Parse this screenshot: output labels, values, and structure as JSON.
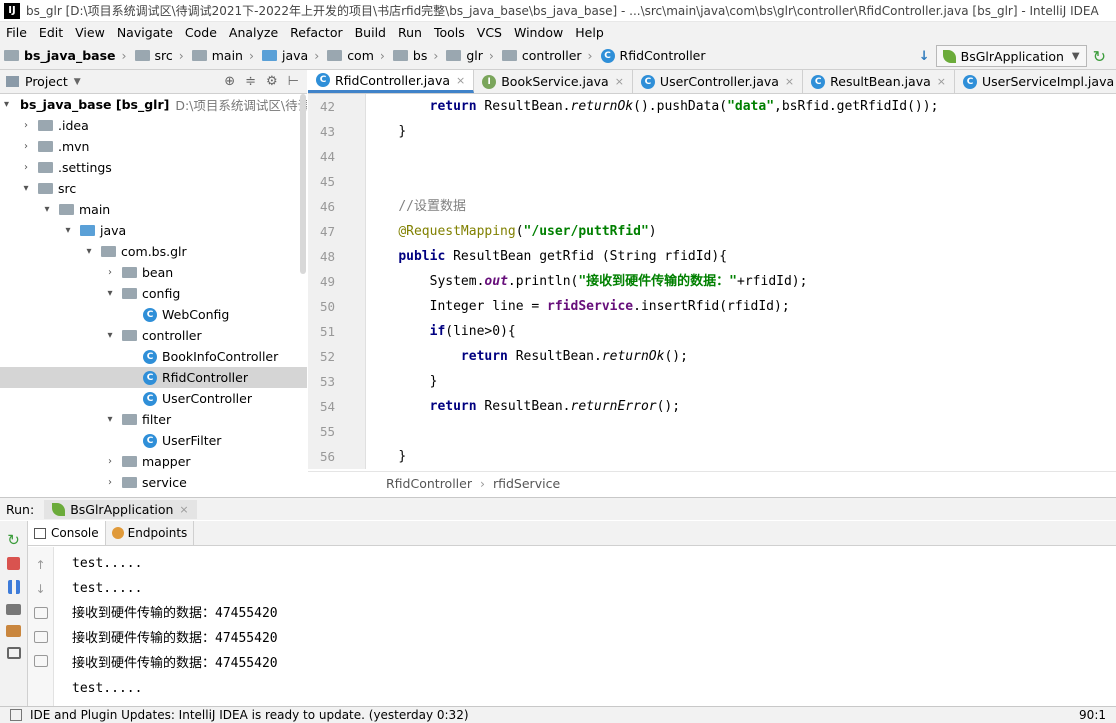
{
  "window": {
    "title": "bs_glr [D:\\项目系统调试区\\待调试2021下-2022年上开发的项目\\书店rfid完整\\bs_java_base\\bs_java_base] - ...\\src\\main\\java\\com\\bs\\glr\\controller\\RfidController.java [bs_glr] - IntelliJ IDEA"
  },
  "menu": [
    "File",
    "Edit",
    "View",
    "Navigate",
    "Code",
    "Analyze",
    "Refactor",
    "Build",
    "Run",
    "Tools",
    "VCS",
    "Window",
    "Help"
  ],
  "breadcrumb": [
    "bs_java_base",
    "src",
    "main",
    "java",
    "com",
    "bs",
    "glr",
    "controller",
    "RfidController"
  ],
  "run_config": "BsGlrApplication",
  "project_panel": {
    "title": "Project",
    "tree": [
      {
        "label": "bs_java_base [bs_glr]",
        "extra": "D:\\项目系统调试区\\待调试",
        "arrow": "open"
      },
      {
        "label": ".idea",
        "arrow": "closed"
      },
      {
        "label": ".mvn",
        "arrow": "closed"
      },
      {
        "label": ".settings",
        "arrow": "closed"
      },
      {
        "label": "src",
        "arrow": "open"
      },
      {
        "label": "main",
        "arrow": "open"
      },
      {
        "label": "java",
        "arrow": "open"
      },
      {
        "label": "com.bs.glr",
        "arrow": "open"
      },
      {
        "label": "bean",
        "arrow": "closed"
      },
      {
        "label": "config",
        "arrow": "open"
      },
      {
        "label": "WebConfig",
        "arrow": "none"
      },
      {
        "label": "controller",
        "arrow": "open"
      },
      {
        "label": "BookInfoController",
        "arrow": "none"
      },
      {
        "label": "RfidController",
        "arrow": "none",
        "selected": true
      },
      {
        "label": "UserController",
        "arrow": "none"
      },
      {
        "label": "filter",
        "arrow": "open"
      },
      {
        "label": "UserFilter",
        "arrow": "none"
      },
      {
        "label": "mapper",
        "arrow": "closed"
      },
      {
        "label": "service",
        "arrow": "closed"
      }
    ]
  },
  "editor_tabs": [
    "RfidController.java",
    "BookService.java",
    "UserController.java",
    "ResultBean.java",
    "UserServiceImpl.java",
    "Us"
  ],
  "line_numbers": [
    "42",
    "43",
    "44",
    "45",
    "46",
    "47",
    "48",
    "49",
    "50",
    "51",
    "52",
    "53",
    "54",
    "55",
    "56"
  ],
  "code": {
    "l42_kw": "return",
    "l42_a": " ResultBean.",
    "l42_m": "returnOk",
    "l42_b": "().pushData(",
    "l42_s": "\"data\"",
    "l42_c": ",bsRfid.getRfidId());",
    "l43": "}",
    "l46": "//设置数据",
    "l47_a": "@RequestMapping",
    "l47_b": "(",
    "l47_s": "\"/user/puttRfid\"",
    "l47_c": ")",
    "l48_kw": "public",
    "l48_a": " ResultBean getRfid (String rfidId){",
    "l49_a": "System.",
    "l49_f": "out",
    "l49_b": ".println(",
    "l49_s": "\"接收到硬件传输的数据：\"",
    "l49_c": "+rfidId);",
    "l50_a": "Integer line = ",
    "l50_f": "rfidService",
    "l50_b": ".insertRfid(rfidId);",
    "l51_kw": "if",
    "l51_a": "(line>0){",
    "l52_kw": "return",
    "l52_a": " ResultBean.",
    "l52_m": "returnOk",
    "l52_b": "();",
    "l53": "}",
    "l54_kw": "return",
    "l54_a": " ResultBean.",
    "l54_m": "returnError",
    "l54_b": "();",
    "l56": "}"
  },
  "editor_breadcrumb": [
    "RfidController",
    "rfidService"
  ],
  "run_panel": {
    "label": "Run:",
    "tab": "BsGlrApplication",
    "console_tab": "Console",
    "endpoints_tab": "Endpoints",
    "output": [
      "test.....",
      "test.....",
      "接收到硬件传输的数据：47455420",
      "接收到硬件传输的数据：47455420",
      "接收到硬件传输的数据：47455420",
      "test....."
    ]
  },
  "status": {
    "message": "IDE and Plugin Updates: IntelliJ IDEA is ready to update. (yesterday 0:32)",
    "position": "90:1"
  }
}
